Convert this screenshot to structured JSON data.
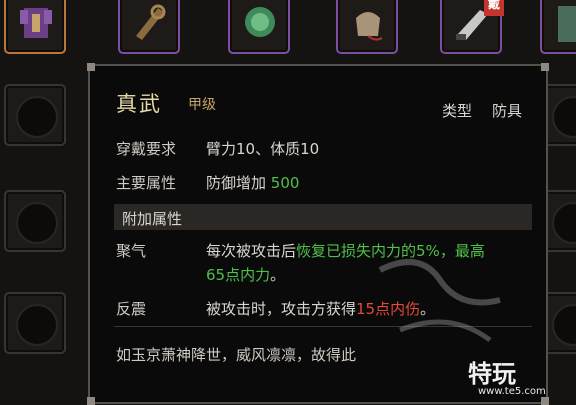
{
  "inventory": {
    "badge_text": "戴"
  },
  "tooltip": {
    "name": "真武",
    "grade": "甲级",
    "type_label": "类型",
    "type_value": "防具",
    "requirement_label": "穿戴要求",
    "requirement_value": "臂力10、体质10",
    "main_attr_label": "主要属性",
    "main_attr_value": "防御增加",
    "main_attr_amount": "500",
    "extra_section_title": "附加属性",
    "juqi_label": "聚气",
    "juqi_text_a": "每次被攻击后",
    "juqi_text_b": "恢复已损失内力的5%，最高",
    "juqi_text_c": "65点内力",
    "juqi_text_d": "。",
    "fanzhen_label": "反震",
    "fanzhen_text_a": "被攻击时，攻击方获得",
    "fanzhen_text_b": "15点内伤",
    "fanzhen_text_c": "。",
    "description": "如玉京萧神降世，威风凛凛，故得此"
  },
  "watermark": {
    "logo_text": "特玩",
    "url": "www.te5.com"
  },
  "colors": {
    "green": "#4fc14a",
    "red": "#e34a3a",
    "gold_border": "#b9783a",
    "purple_border": "#7d4ea0"
  }
}
